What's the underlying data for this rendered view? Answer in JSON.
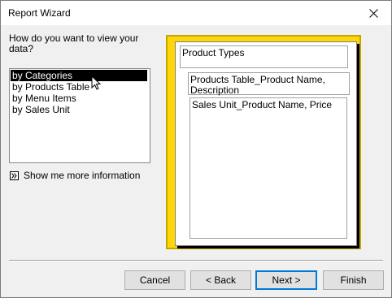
{
  "window": {
    "title": "Report Wizard"
  },
  "prompt": "How do you want to view your data?",
  "view_options": [
    {
      "label": "by Categories",
      "selected": true
    },
    {
      "label": "by Products Table",
      "selected": false
    },
    {
      "label": "by Menu Items",
      "selected": false
    },
    {
      "label": "by Sales Unit",
      "selected": false
    }
  ],
  "more_info_label": "Show me more information",
  "preview": {
    "level1": "Product Types",
    "level2": "Products Table_Product Name, Description",
    "detail": "Sales Unit_Product Name, Price"
  },
  "buttons": {
    "cancel": "Cancel",
    "back": "< Back",
    "next": "Next >",
    "finish": "Finish"
  },
  "colors": {
    "preview_background": "#fed709",
    "selection": "#000000",
    "default_button_border": "#0078d7"
  }
}
